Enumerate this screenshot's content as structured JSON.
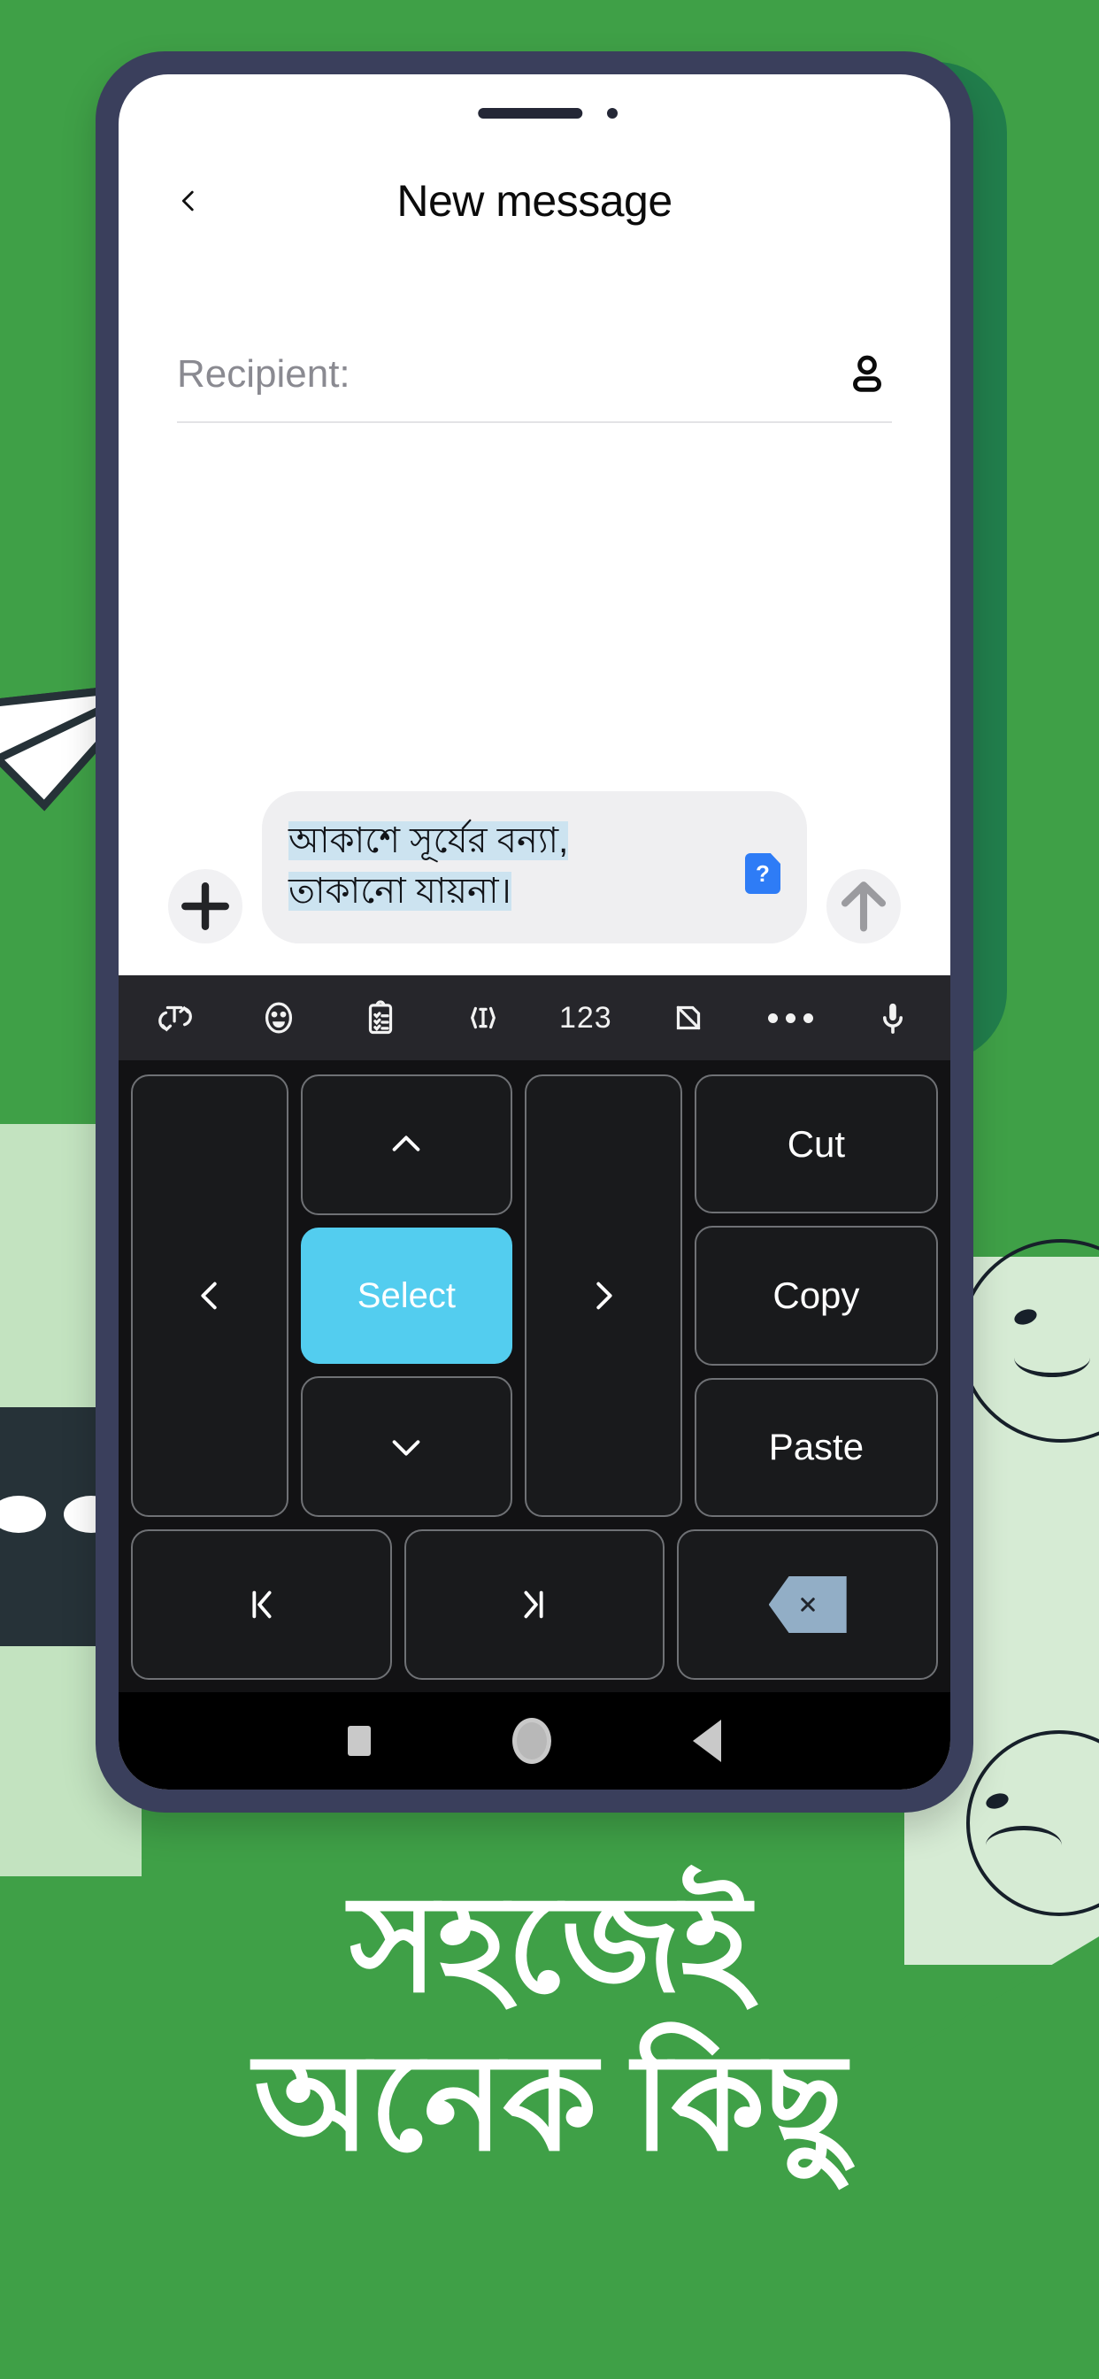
{
  "theme": {
    "background_green": "#3FA047",
    "phone_frame": "#3A3F5C",
    "accent_cyan": "#53CDEF",
    "selection_blue": "#CCE3F0",
    "sim_badge_blue": "#2E7CF6",
    "keyboard_bg": "#121214",
    "toolbar_bg": "#26262B"
  },
  "app": {
    "title": "New message",
    "back_icon": "chevron-left-icon"
  },
  "recipient": {
    "placeholder": "Recipient:",
    "value": "",
    "contact_icon": "person-icon"
  },
  "composer": {
    "attach_icon": "plus-icon",
    "send_icon": "arrow-up-icon",
    "message_line1": "আকাশে সূর্যের বন্যা,",
    "message_line2": "তাকানো যায়না।",
    "sim_badge_label": "?",
    "sim_badge_icon": "sim-card-icon"
  },
  "keyboard": {
    "toolbar": [
      {
        "name": "text-rotate-icon",
        "label": ""
      },
      {
        "name": "emoji-icon",
        "label": ""
      },
      {
        "name": "clipboard-icon",
        "label": ""
      },
      {
        "name": "text-cursor-icon",
        "label": ""
      },
      {
        "name": "numbers-icon",
        "label": "123"
      },
      {
        "name": "sticker-off-icon",
        "label": ""
      },
      {
        "name": "more-icon",
        "label": ""
      },
      {
        "name": "microphone-icon",
        "label": ""
      }
    ],
    "nav_left_icon": "chevron-left-icon",
    "nav_right_icon": "chevron-right-icon",
    "nav_up_icon": "chevron-up-icon",
    "nav_down_icon": "chevron-down-icon",
    "select_label": "Select",
    "cut_label": "Cut",
    "copy_label": "Copy",
    "paste_label": "Paste",
    "home_icon": "jump-to-start-icon",
    "end_icon": "jump-to-end-icon",
    "backspace_icon": "backspace-icon"
  },
  "navbar": {
    "recents_icon": "square-recents-icon",
    "home_icon": "circle-home-icon",
    "back_icon": "triangle-back-icon"
  },
  "headline": {
    "line1": "সহজেই",
    "line2": "অনেক কিছু"
  },
  "decor": {
    "paper_plane": "paper-plane-illustration",
    "smiley_top": "smiley-face-illustration",
    "smiley_bottom": "sad-face-illustration"
  }
}
